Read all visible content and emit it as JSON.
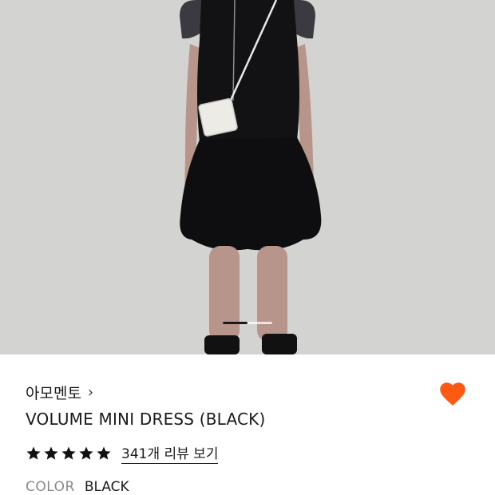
{
  "product_image": {
    "alt_icon": "product-photo",
    "pager": {
      "current": 1,
      "total": 2
    }
  },
  "product": {
    "brand": "아모멘토",
    "brand_chevron": "›",
    "title": "VOLUME MINI DRESS (BLACK)",
    "rating": 5,
    "reviews_label": "341개 리뷰 보기",
    "color_label": "COLOR",
    "color_value": "BLACK",
    "wishlisted": true
  },
  "colors": {
    "heart": "#ff5a12",
    "star": "#111111",
    "background_photo": "#d3d3d1"
  }
}
